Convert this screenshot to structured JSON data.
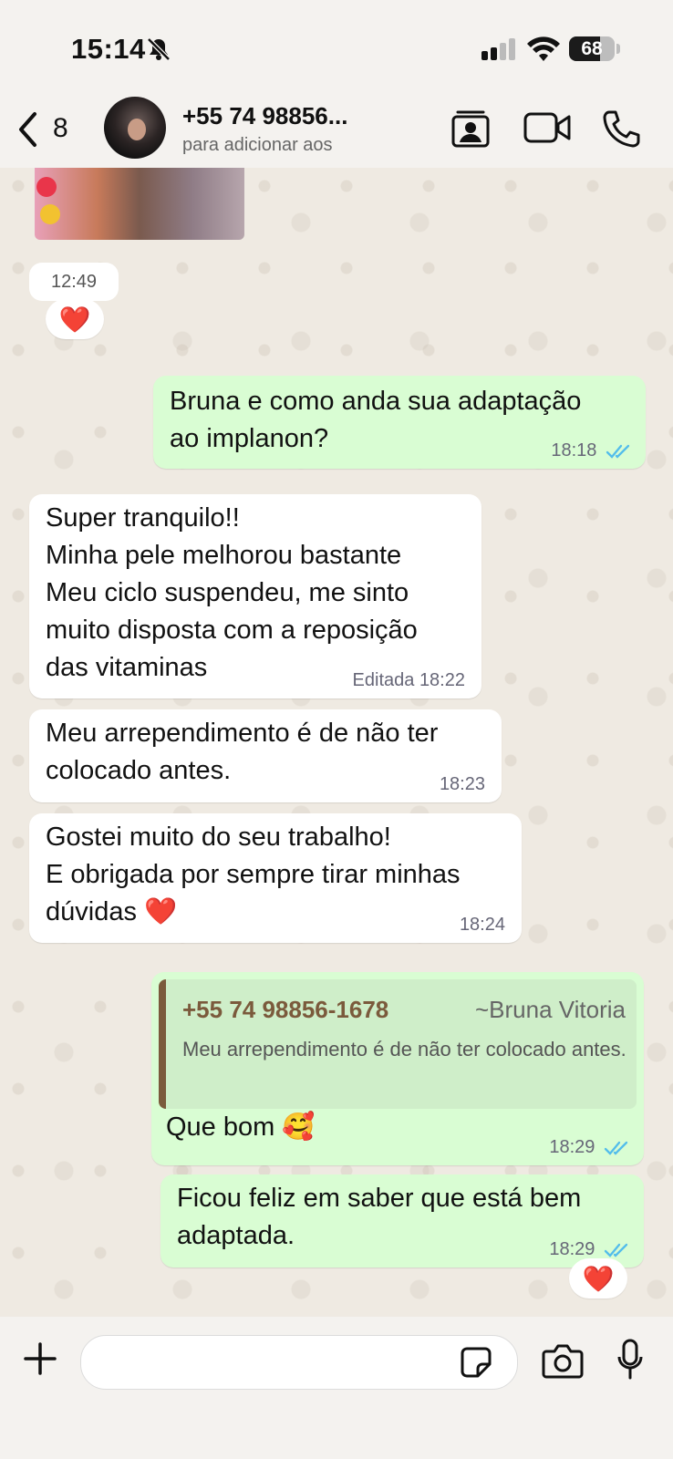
{
  "status_bar": {
    "time": "15:14",
    "battery": "68",
    "battery_level": 0.68
  },
  "header": {
    "back_count": "8",
    "contact_name": "+55 74 98856...",
    "contact_subtitle": "para adicionar aos"
  },
  "chat": {
    "reaction_emoji": "❤️",
    "timestamp_chip": "12:49",
    "messages": [
      {
        "direction": "out",
        "text": "Bruna e como anda sua adaptação\nao implanon?",
        "time": "18:18"
      },
      {
        "direction": "in",
        "text": "Super tranquilo!!\nMinha pele melhorou bastante\nMeu ciclo suspendeu, me sinto\nmuito disposta com a reposição\ndas vitaminas",
        "edited_label": "Editada",
        "time": "18:22"
      },
      {
        "direction": "in",
        "text": "Meu arrependimento é de não ter\ncolocado antes.",
        "time": "18:23"
      },
      {
        "direction": "in",
        "text": "Gostei muito do seu trabalho!\nE obrigada por sempre tirar minhas\ndúvidas ❤️",
        "time": "18:24"
      },
      {
        "direction": "out",
        "quote": {
          "phone": "+55 74 98856-1678",
          "name": "~Bruna Vitoria",
          "text": "Meu arrependimento é de não ter colocado antes."
        },
        "text": "Que bom 🥰",
        "time": "18:29"
      },
      {
        "direction": "out",
        "text": "Ficou feliz em saber que está bem\nadaptada.",
        "time": "18:29"
      }
    ]
  },
  "composer": {
    "placeholder": ""
  },
  "colors": {
    "outgoing_bubble": "#d9fdd3",
    "incoming_bubble": "#ffffff",
    "read_ticks": "#53bdeb",
    "quote_accent": "#7b5a3c"
  }
}
